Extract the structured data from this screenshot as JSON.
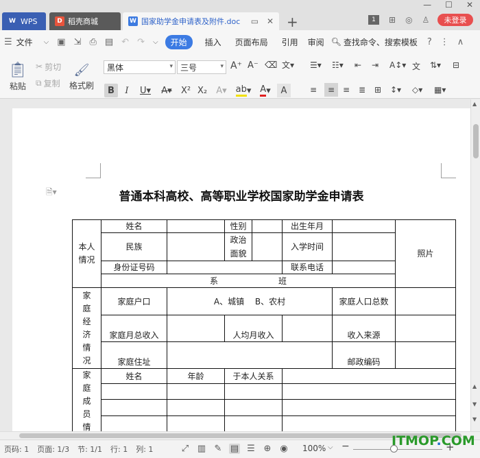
{
  "titlebar": {
    "tabs": [
      {
        "label": "WPS",
        "icon": "wps-logo-icon"
      },
      {
        "label": "稻壳商城",
        "icon": "docer-icon"
      },
      {
        "label": "国家助学金申请表及附件.doc",
        "icon": "word-doc-icon"
      }
    ],
    "badge": "1",
    "login": "未登录"
  },
  "menubar": {
    "file": "文件",
    "tabs": [
      "开始",
      "插入",
      "页面布局",
      "引用",
      "审阅"
    ],
    "active_tab": "开始",
    "search": "查找命令、搜索模板"
  },
  "ribbon": {
    "paste": "粘贴",
    "cut": "剪切",
    "copy": "复制",
    "format_painter": "格式刷",
    "font_name": "黑体",
    "font_size": "三号"
  },
  "document": {
    "title": "普通本科高校、高等职业学校国家助学金申请表",
    "table": {
      "personal": "本人情况",
      "name": "姓名",
      "gender": "性别",
      "birth": "出生年月",
      "ethnic": "民族",
      "political": "政治面貌",
      "enroll": "入学时间",
      "id_no": "身份证号码",
      "phone": "联系电话",
      "photo": "照片",
      "dept": "系",
      "class": "班",
      "family_econ": "家庭经济情况",
      "household": "家庭户口",
      "household_options": "A、城镇　 B、农村",
      "family_count": "家庭人口总数",
      "monthly_income": "家庭月总收入",
      "per_capita": "人均月收入",
      "income_source": "收入来源",
      "address": "家庭住址",
      "postcode": "邮政编码",
      "members": "家庭成员情况",
      "m_name": "姓名",
      "m_age": "年龄",
      "m_relation": "于本人关系"
    }
  },
  "statusbar": {
    "page_no": "页码: 1",
    "pages": "页面: 1/3",
    "section": "节: 1/1",
    "row": "行: 1",
    "col": "列: 1",
    "zoom": "100%"
  },
  "watermark": {
    "text": "ITMOP",
    "dot": ".",
    "suffix": "COM"
  }
}
